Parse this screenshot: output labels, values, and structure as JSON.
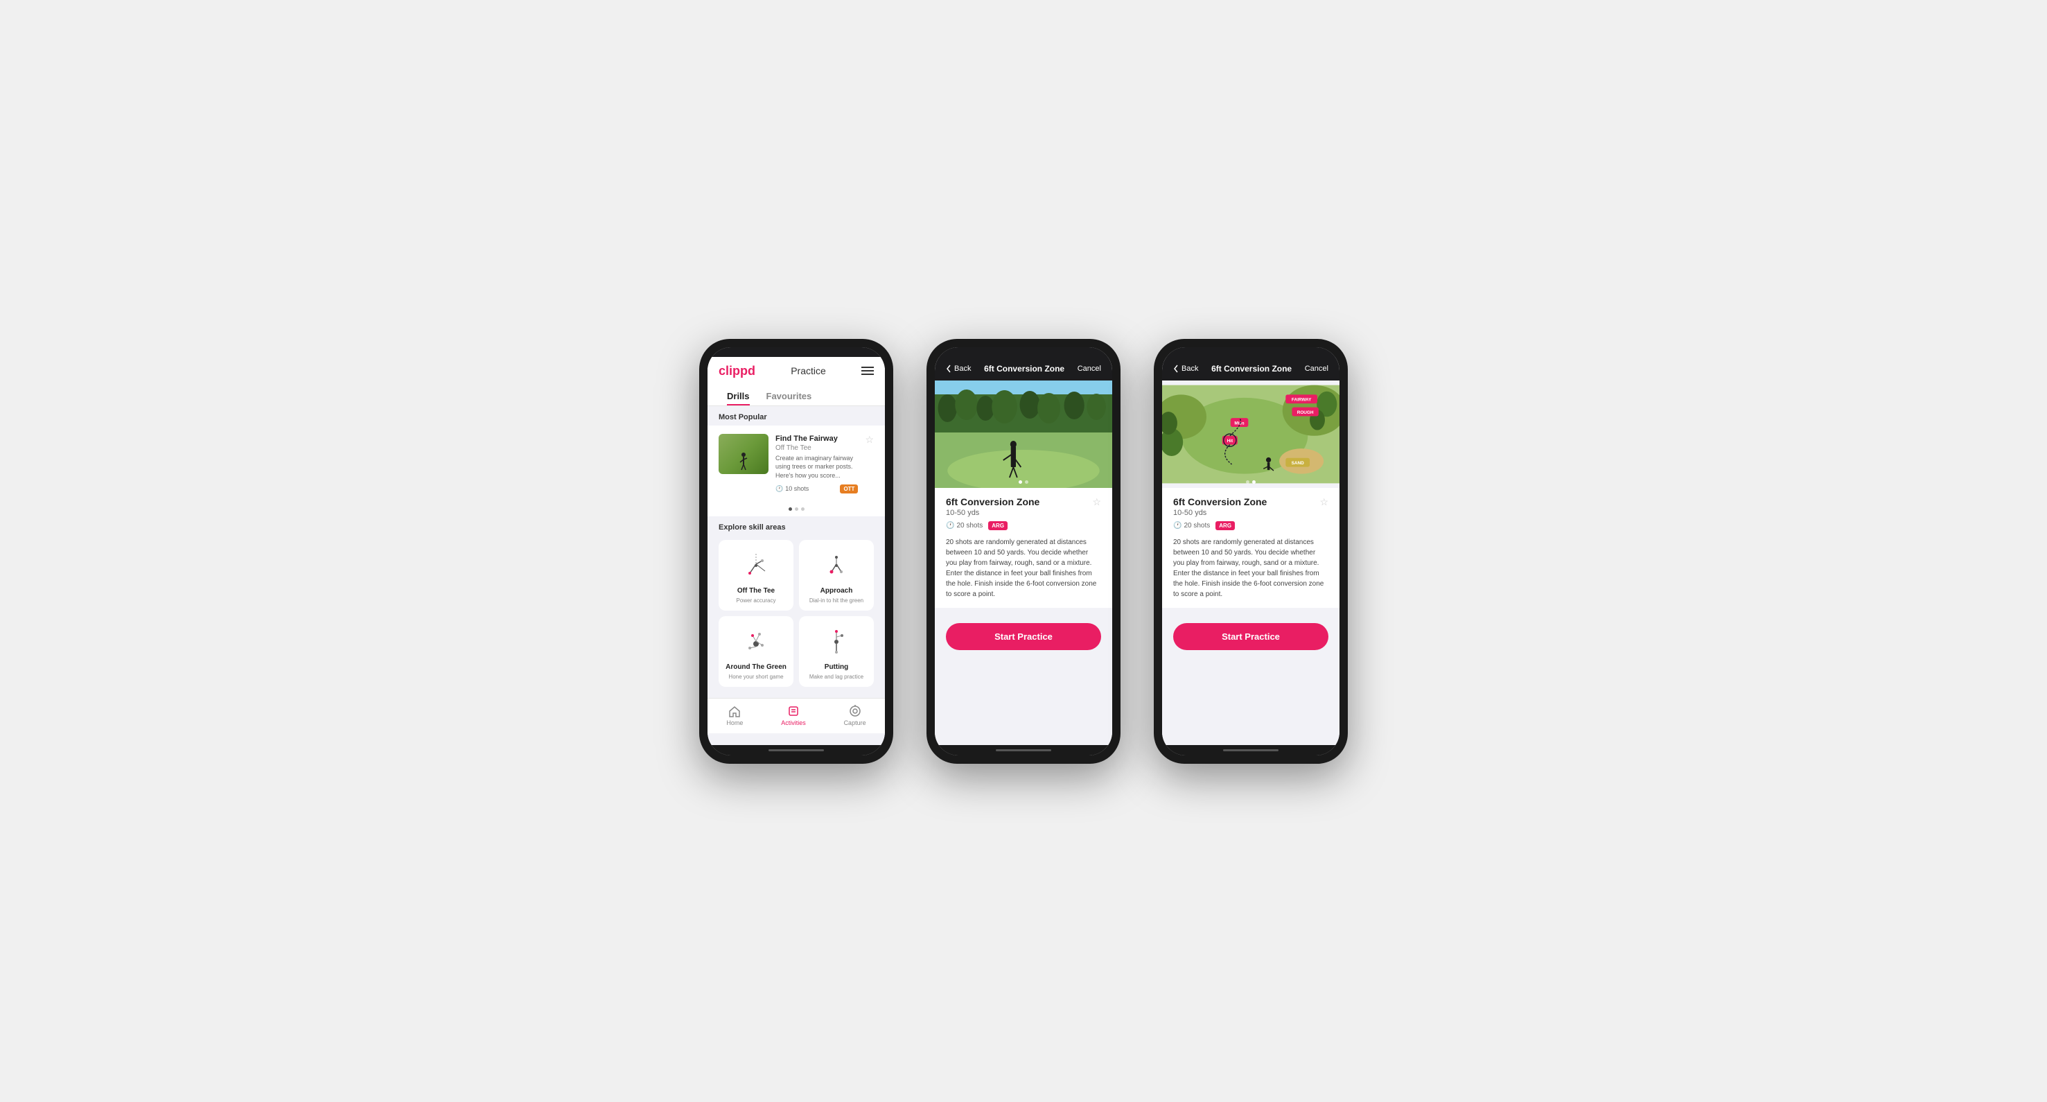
{
  "phone1": {
    "logo": "clippd",
    "nav_title": "Practice",
    "tabs": [
      {
        "label": "Drills",
        "active": true
      },
      {
        "label": "Favourites",
        "active": false
      }
    ],
    "most_popular_label": "Most Popular",
    "featured_drill": {
      "title": "Find The Fairway",
      "subtitle": "Off The Tee",
      "description": "Create an imaginary fairway using trees or marker posts. Here's how you score...",
      "shots": "10 shots",
      "tag": "OTT"
    },
    "explore_label": "Explore skill areas",
    "skill_areas": [
      {
        "name": "Off The Tee",
        "desc": "Power accuracy"
      },
      {
        "name": "Approach",
        "desc": "Dial-in to hit the green"
      },
      {
        "name": "Around The Green",
        "desc": "Hone your short game"
      },
      {
        "name": "Putting",
        "desc": "Make and lag practice"
      }
    ],
    "bottom_nav": [
      {
        "label": "Home",
        "active": false
      },
      {
        "label": "Activities",
        "active": true
      },
      {
        "label": "Capture",
        "active": false
      }
    ]
  },
  "phone2": {
    "back_label": "Back",
    "title": "6ft Conversion Zone",
    "cancel_label": "Cancel",
    "drill_title": "6ft Conversion Zone",
    "distance": "10-50 yds",
    "shots": "20 shots",
    "tag": "ARG",
    "description": "20 shots are randomly generated at distances between 10 and 50 yards. You decide whether you play from fairway, rough, sand or a mixture. Enter the distance in feet your ball finishes from the hole. Finish inside the 6-foot conversion zone to score a point.",
    "start_btn": "Start Practice",
    "image_type": "photo"
  },
  "phone3": {
    "back_label": "Back",
    "title": "6ft Conversion Zone",
    "cancel_label": "Cancel",
    "drill_title": "6ft Conversion Zone",
    "distance": "10-50 yds",
    "shots": "20 shots",
    "tag": "ARG",
    "description": "20 shots are randomly generated at distances between 10 and 50 yards. You decide whether you play from fairway, rough, sand or a mixture. Enter the distance in feet your ball finishes from the hole. Finish inside the 6-foot conversion zone to score a point.",
    "start_btn": "Start Practice",
    "image_type": "map"
  },
  "icons": {
    "clock": "🕐",
    "star_empty": "☆",
    "chevron_left": "‹",
    "home": "⌂",
    "activities": "♣",
    "capture": "⊕"
  }
}
